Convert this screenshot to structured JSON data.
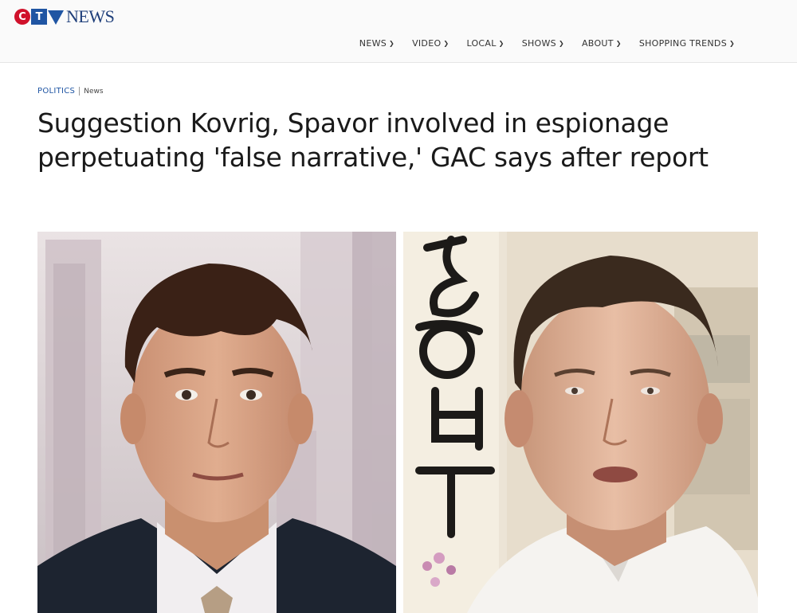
{
  "header": {
    "logo": {
      "c": "C",
      "t": "T",
      "news": "NEWS"
    },
    "nav": [
      {
        "label": "NEWS"
      },
      {
        "label": "VIDEO"
      },
      {
        "label": "LOCAL"
      },
      {
        "label": "SHOWS"
      },
      {
        "label": "ABOUT"
      },
      {
        "label": "SHOPPING TRENDS"
      }
    ]
  },
  "article": {
    "section": "POLITICS",
    "subsection": "News",
    "headline": "Suggestion Kovrig, Spavor involved in espionage perpetuating 'false narrative,' GAC says after report"
  },
  "colors": {
    "brand_red": "#d0112b",
    "brand_blue": "#1f55a3",
    "section_blue": "#1f55a3"
  },
  "icons": {
    "nav_dropdown": "chevron-down-icon"
  }
}
